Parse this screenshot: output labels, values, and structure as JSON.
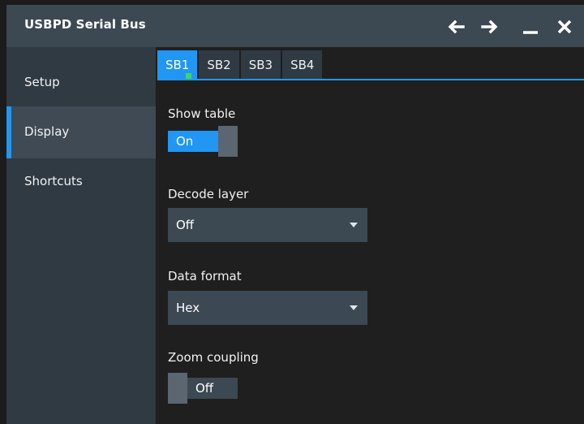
{
  "window": {
    "title": "USBPD Serial Bus"
  },
  "titlebar_icons": [
    "arrow-left-icon",
    "arrow-right-icon",
    "minimize-icon",
    "close-icon"
  ],
  "sidebar": {
    "items": [
      {
        "label": "Setup",
        "active": false
      },
      {
        "label": "Display",
        "active": true
      },
      {
        "label": "Shortcuts",
        "active": false
      }
    ]
  },
  "tabs": [
    {
      "label": "SB1",
      "active": true,
      "indicator_color": "#39d86b"
    },
    {
      "label": "SB2",
      "active": false
    },
    {
      "label": "SB3",
      "active": false
    },
    {
      "label": "SB4",
      "active": false
    }
  ],
  "settings": {
    "show_table": {
      "label": "Show table",
      "state": "On"
    },
    "decode_layer": {
      "label": "Decode layer",
      "value": "Off"
    },
    "data_format": {
      "label": "Data format",
      "value": "Hex"
    },
    "zoom_coupling": {
      "label": "Zoom coupling",
      "state": "Off"
    }
  },
  "colors": {
    "accent": "#2196f3",
    "titlebar": "#3c4852",
    "sidebar": "#2f3a43",
    "background": "#1f1f1f"
  }
}
